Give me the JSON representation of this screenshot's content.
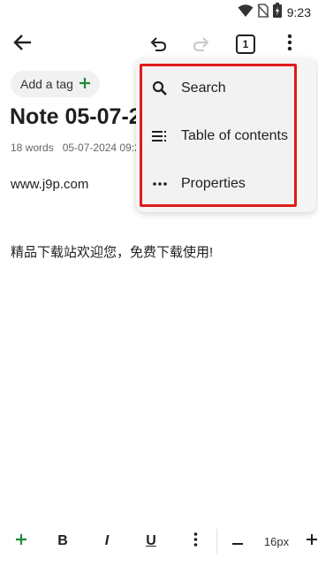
{
  "status": {
    "time": "9:23"
  },
  "toolbar": {
    "tab_count": "1"
  },
  "tag": {
    "label": "Add a tag"
  },
  "note": {
    "title": "Note 05-07-2",
    "word_count": "18 words",
    "date": "05-07-2024 09:2",
    "paragraphs": [
      "www.j9p.com",
      "精品下载站欢迎您，免费下载使用!"
    ]
  },
  "menu": {
    "items": [
      {
        "label": "Search",
        "icon": "search-icon"
      },
      {
        "label": "Table of contents",
        "icon": "toc-icon"
      },
      {
        "label": "Properties",
        "icon": "more-horizontal-icon"
      }
    ]
  },
  "format_bar": {
    "bold": "B",
    "italic": "I",
    "underline": "U",
    "font_size": "16px"
  },
  "colors": {
    "accent": "#1e8a3e",
    "highlight_border": "#e01a1a"
  }
}
